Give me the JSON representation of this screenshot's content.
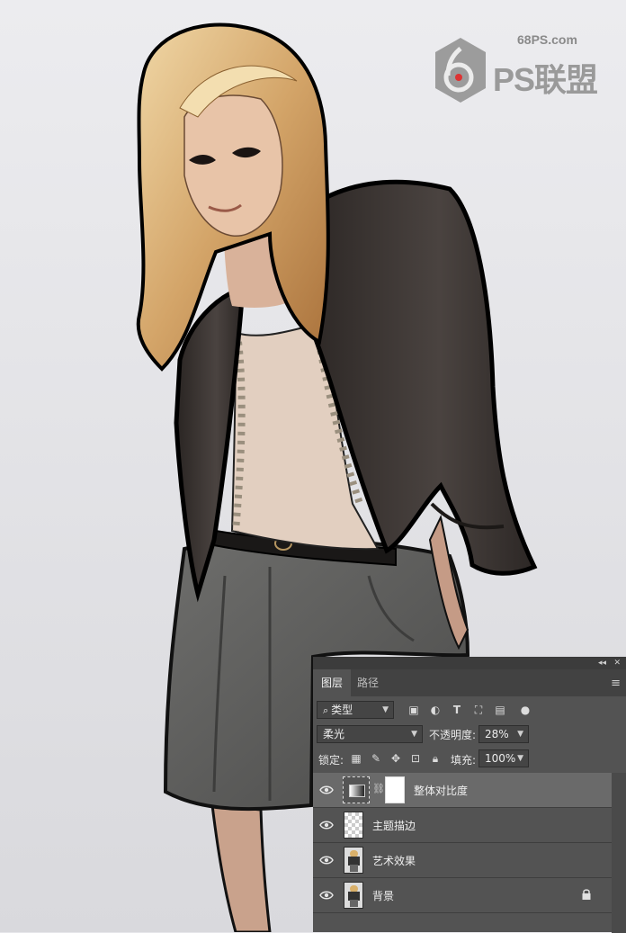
{
  "watermark": {
    "site": "68PS.com",
    "logo_text": "PS联盟"
  },
  "panel": {
    "tabs": [
      {
        "label": "图层",
        "active": true
      },
      {
        "label": "路径",
        "active": false
      }
    ],
    "filter": {
      "label": "类型",
      "icons": [
        "image-filter-icon",
        "adjustment-filter-icon",
        "text-filter-icon",
        "shape-filter-icon",
        "smartobject-filter-icon",
        "filter-toggle-icon"
      ]
    },
    "blend_mode": "柔光",
    "opacity_label": "不透明度:",
    "opacity_value": "28%",
    "lock_label": "锁定:",
    "lock_icons": [
      "lock-transparency-icon",
      "lock-paint-icon",
      "lock-position-icon",
      "lock-artboard-icon",
      "lock-all-icon"
    ],
    "fill_label": "填充:",
    "fill_value": "100%",
    "layers": [
      {
        "name": "整体对比度",
        "type": "adjustment",
        "selected": true
      },
      {
        "name": "主题描边",
        "type": "transparent",
        "selected": false
      },
      {
        "name": "艺术效果",
        "type": "photo",
        "selected": false
      },
      {
        "name": "背景",
        "type": "photo",
        "locked": true,
        "selected": false
      }
    ]
  },
  "colors": {
    "panel_bg": "#535353",
    "panel_dark": "#424242",
    "selected_row": "#6a6a6a",
    "canvas_bg": "#e6e6ea"
  }
}
